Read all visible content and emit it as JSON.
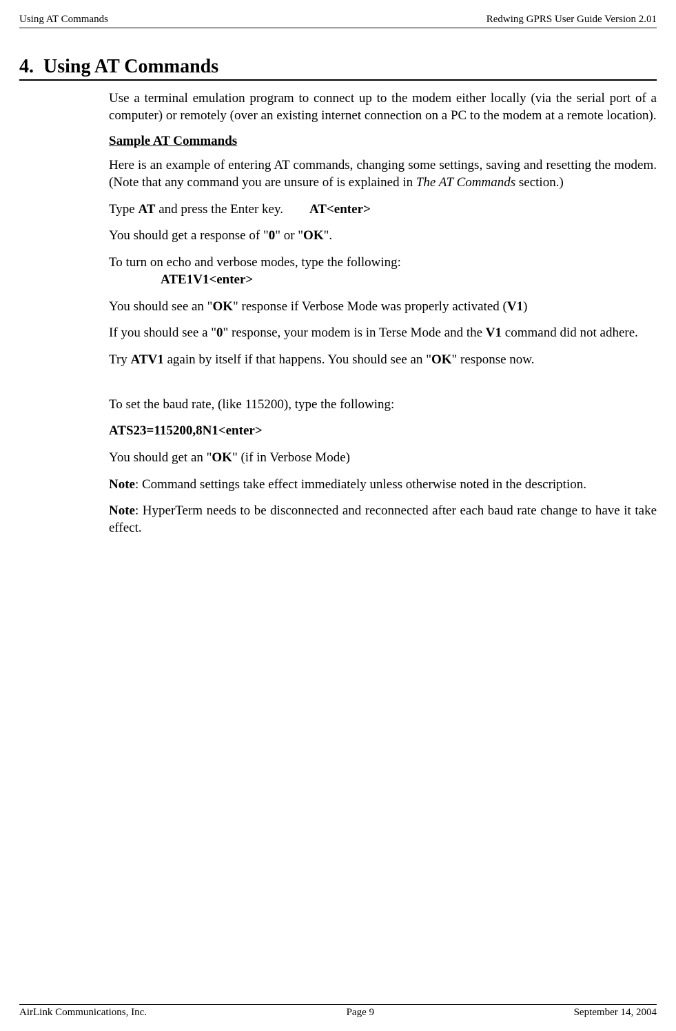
{
  "header": {
    "left": "Using AT Commands",
    "right": "Redwing GPRS User Guide Version 2.01"
  },
  "section": {
    "number": "4.",
    "title": "Using AT Commands"
  },
  "content": {
    "intro": "Use a terminal emulation program to connect up to the modem either locally (via the serial port of a computer) or remotely (over an existing internet connection on a PC to the modem at a remote location).",
    "subheading": "Sample AT Commands",
    "p1_a": "Here is an example of entering AT commands, changing some settings, saving and resetting the modem. (Note that any command you are unsure of is explained in ",
    "p1_italic": "The AT Commands",
    "p1_b": " section.)",
    "p2_a": "Type ",
    "p2_bold1": "AT",
    "p2_b": " and press the Enter key.",
    "p2_bold2": "AT<enter>",
    "p3_a": "You should get a response of \"",
    "p3_bold1": "0",
    "p3_b": "\" or \"",
    "p3_bold2": "OK",
    "p3_c": "\".",
    "p4": "To turn on echo and verbose modes, type the following:",
    "p4_cmd": "ATE1V1<enter>",
    "p5_a": "You should see an \"",
    "p5_bold1": "OK",
    "p5_b": "\" response if Verbose Mode was properly activated (",
    "p5_bold2": "V1",
    "p5_c": ")",
    "p6_a": "If you should see a \"",
    "p6_bold1": "0",
    "p6_b": "\" response, your modem is in Terse Mode and the ",
    "p6_bold2": "V1",
    "p6_c": " command did not adhere.",
    "p7_a": "Try ",
    "p7_bold1": "ATV1",
    "p7_b": " again by itself if that happens. You should see an \"",
    "p7_bold2": "OK",
    "p7_c": "\" response now.",
    "p8": "To set the baud rate, (like 115200), type the following:",
    "p9": "ATS23=115200,8N1<enter>",
    "p10_a": "You should get an \"",
    "p10_bold": "OK",
    "p10_b": "\" (if in Verbose Mode)",
    "p11_bold": "Note",
    "p11": ": Command settings take effect immediately unless otherwise noted in the description.",
    "p12_bold": "Note",
    "p12": ": HyperTerm needs to be disconnected and reconnected after each baud rate change to have it take effect."
  },
  "footer": {
    "left": "AirLink Communications, Inc.",
    "center": "Page 9",
    "right": "September 14, 2004"
  }
}
